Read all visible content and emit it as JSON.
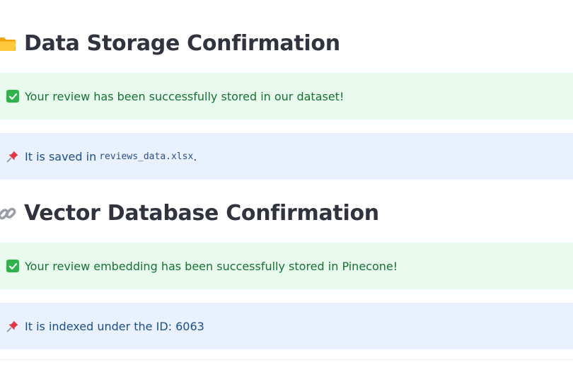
{
  "sections": [
    {
      "heading": "Data Storage Confirmation",
      "heading_icon": "folder-icon",
      "success_message": "Your review has been successfully stored in our dataset!",
      "info_prefix": "It is saved in",
      "info_code": "reviews_data.xlsx",
      "info_suffix": "."
    },
    {
      "heading": "Vector Database Confirmation",
      "heading_icon": "link-icon",
      "success_message": "Your review embedding has been successfully stored in Pinecone!",
      "info_message": "It is indexed under the ID: 6063"
    }
  ],
  "colors": {
    "success_bg": "#e8f9ee",
    "success_text": "#177233",
    "info_bg": "#e8f1fd",
    "info_text": "#1c4e8b",
    "heading_text": "#31333f"
  }
}
